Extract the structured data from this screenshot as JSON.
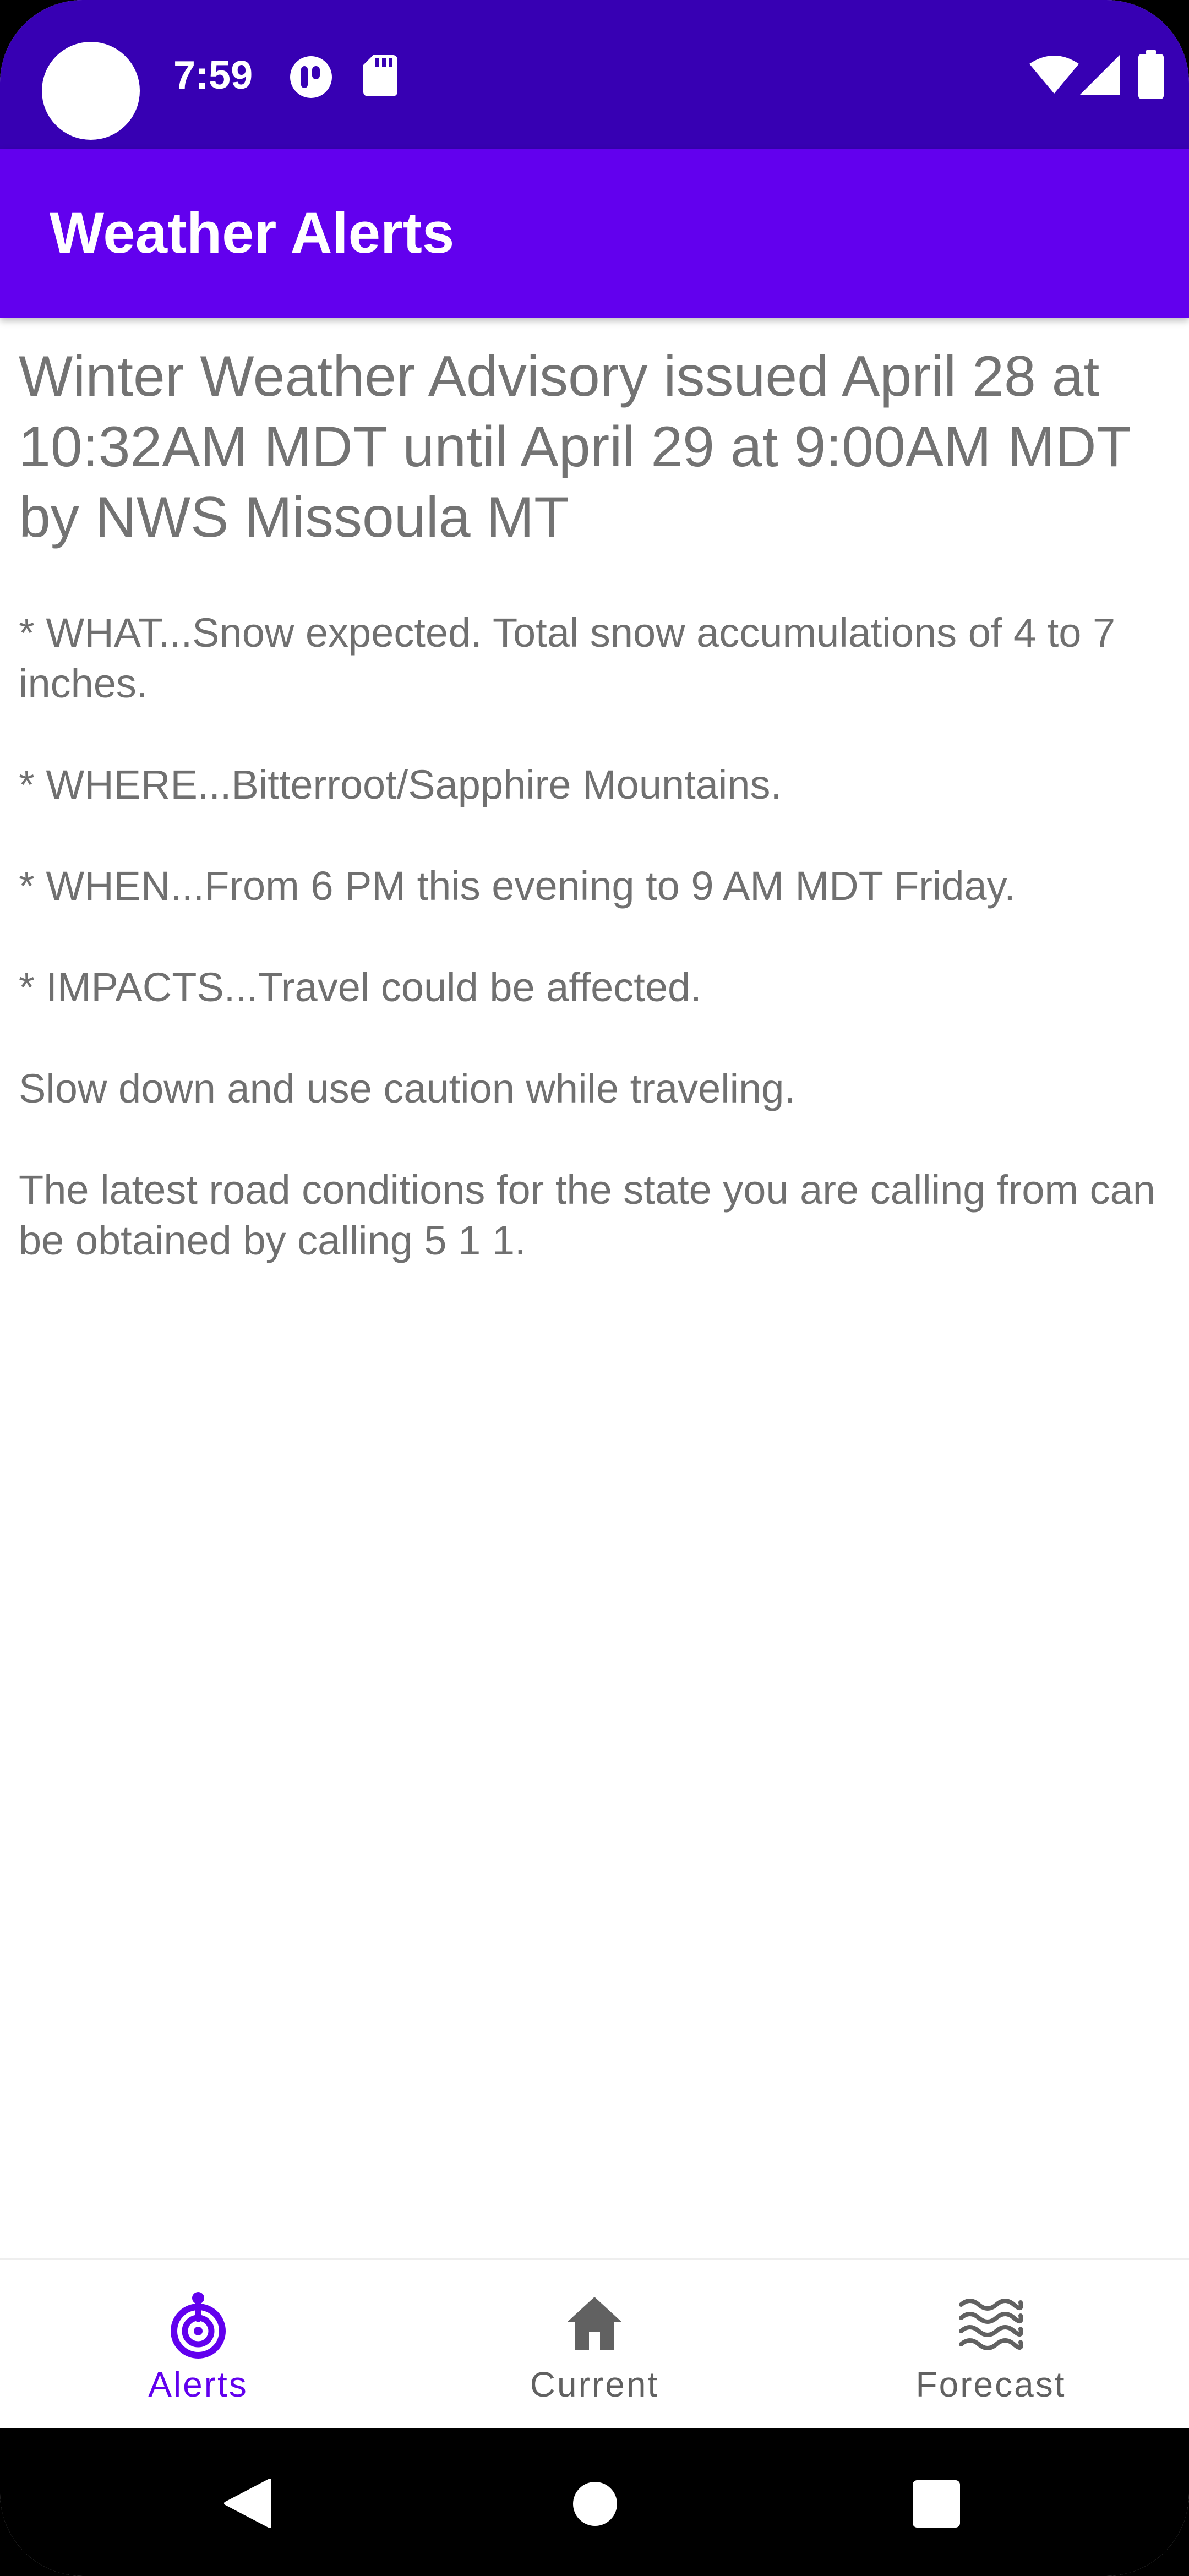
{
  "status_bar": {
    "time": "7:59",
    "icons": [
      "notification-app-icon",
      "sd-card-icon",
      "wifi-icon",
      "cell-signal-icon",
      "battery-icon"
    ]
  },
  "app_bar": {
    "title": "Weather Alerts"
  },
  "alert": {
    "heading": "Winter Weather Advisory issued April 28 at 10:32AM MDT until April 29 at 9:00AM MDT by NWS Missoula MT",
    "what_line1": "* WHAT...Snow expected. Total snow accumulations of 4 to 7",
    "what_line2": "inches.",
    "where": "* WHERE...Bitterroot/Sapphire Mountains.",
    "when": "* WHEN...From 6 PM this evening to 9 AM MDT Friday.",
    "impacts": "* IMPACTS...Travel could be affected.",
    "advice": "Slow down and use caution while traveling.",
    "road_line1": "The latest road conditions for the state you are calling from can",
    "road_line2": "be obtained by calling 5 1 1."
  },
  "bottom_nav": {
    "items": [
      {
        "label": "Alerts",
        "icon": "alerts-icon",
        "active": true
      },
      {
        "label": "Current",
        "icon": "home-icon",
        "active": false
      },
      {
        "label": "Forecast",
        "icon": "waves-icon",
        "active": false
      }
    ]
  },
  "colors": {
    "status_bar": "#3700b3",
    "app_bar": "#6200ee",
    "active_nav": "#6200ee",
    "inactive_nav": "#616161"
  }
}
